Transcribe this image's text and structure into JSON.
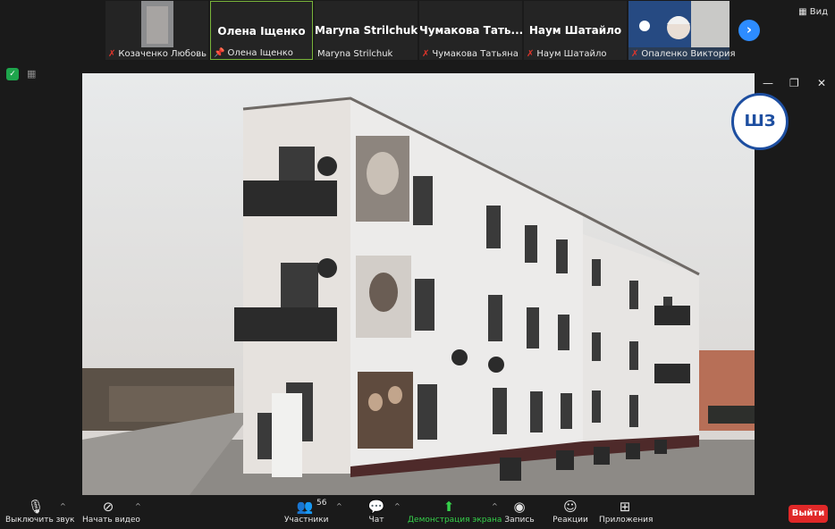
{
  "participants": [
    {
      "name": "Козаченко Любовь",
      "big": "",
      "muted": true
    },
    {
      "name": "Олена Іщенко",
      "big": "Олена Іщенко",
      "muted": false
    },
    {
      "name": "Maryna Strilchuk",
      "big": "Maryna Strilchuk",
      "muted": false
    },
    {
      "name": "Чумакова Татьяна",
      "big": "Чумакова  Тать...",
      "muted": true
    },
    {
      "name": "Наум Шатайло",
      "big": "Наум Шатайло",
      "muted": true
    },
    {
      "name": "Опаленко Виктория",
      "big": "",
      "muted": true
    }
  ],
  "view_label": "Вид",
  "toolbar": {
    "mute": "Выключить звук",
    "video": "Начать видео",
    "participants": "Участники",
    "participants_count": "56",
    "chat": "Чат",
    "share": "Демонстрация экрана",
    "record": "Запись",
    "reactions": "Реакции",
    "apps": "Приложения",
    "leave": "Выйти"
  },
  "colors": {
    "active_border": "#79b43a",
    "share_green": "#35d14a",
    "leave_red": "#e02828",
    "accent_blue": "#2d8cff"
  }
}
